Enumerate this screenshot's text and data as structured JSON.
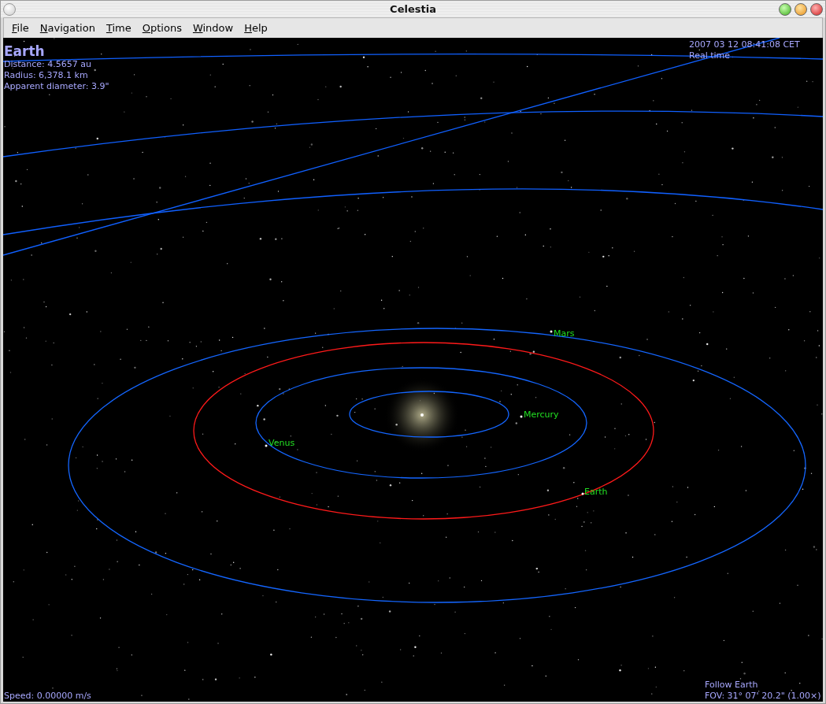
{
  "window": {
    "title": "Celestia"
  },
  "menu": [
    {
      "label": "File"
    },
    {
      "label": "Navigation"
    },
    {
      "label": "Time"
    },
    {
      "label": "Options"
    },
    {
      "label": "Window"
    },
    {
      "label": "Help"
    }
  ],
  "info": {
    "name": "Earth",
    "lines": [
      "Distance: 4.5657 au",
      "Radius: 6,378.1 km",
      "Apparent diameter: 3.9\""
    ]
  },
  "time": {
    "date": "2007 03 12 08:41:08 CET",
    "mode": "Real time"
  },
  "planets": [
    {
      "name": "Mercury",
      "selected": false
    },
    {
      "name": "Venus",
      "selected": false
    },
    {
      "name": "Earth",
      "selected": true
    },
    {
      "name": "Mars",
      "selected": false
    }
  ],
  "speed": "Speed: 0.00000 m/s",
  "follow": "Follow Earth",
  "fov": "FOV: 31° 07' 20.2\" (1.00×)"
}
